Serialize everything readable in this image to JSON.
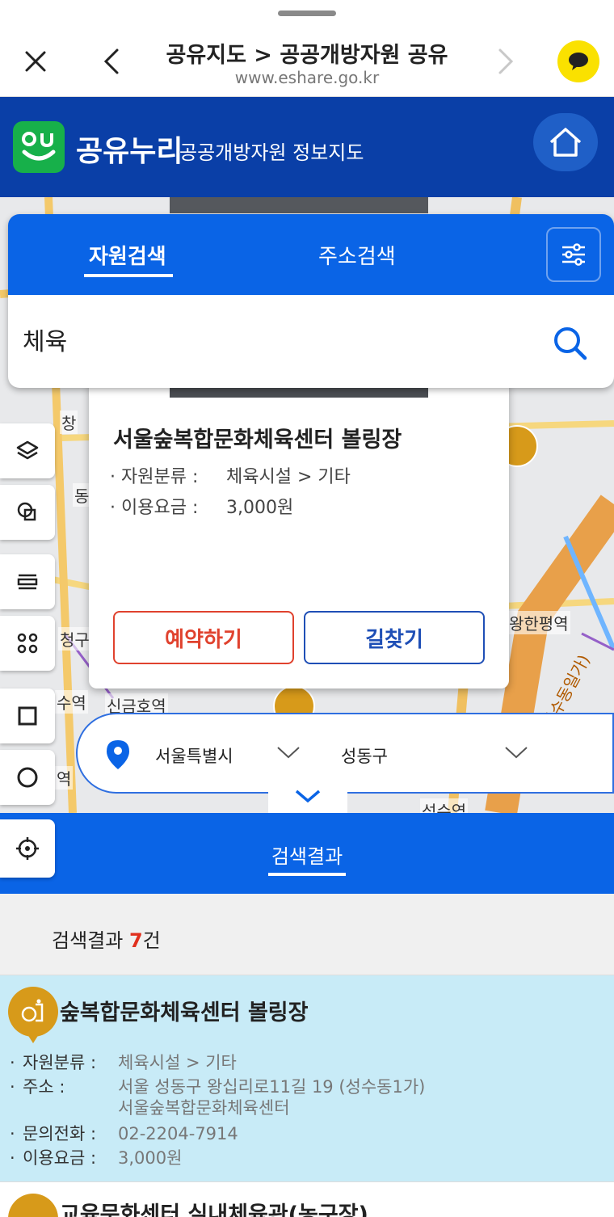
{
  "browser": {
    "title": "공유지도 > 공공개방자원 공유",
    "url": "www.eshare.go.kr"
  },
  "header": {
    "brand": "공유누리",
    "subtitle": "공공개방자원 정보지도"
  },
  "search": {
    "tabs": [
      {
        "label": "자원검색",
        "active": true
      },
      {
        "label": "주소검색",
        "active": false
      }
    ],
    "query": "체육"
  },
  "map": {
    "labels": [
      "창",
      "동",
      "청구",
      "수역",
      "신금호역",
      "역",
      "왕한평역",
      "(성수동일가)",
      "성수역"
    ]
  },
  "popup": {
    "title": "서울숲복합문화체육센터 볼링장",
    "rows": [
      {
        "key": "자원분류 :",
        "value": "체육시설 > 기타"
      },
      {
        "key": "이용요금 :",
        "value": "3,000원"
      }
    ],
    "reserve_label": "예약하기",
    "route_label": "길찾기"
  },
  "region": {
    "city": "서울특별시",
    "district": "성동구"
  },
  "results": {
    "tab_label": "검색결과",
    "count_prefix": "검색결과 ",
    "count": "7",
    "count_suffix": "건",
    "items": [
      {
        "title": "숲복합문화체육센터 볼링장",
        "category_key": "자원분류 :",
        "category": "체육시설 > 기타",
        "address_key": "주소 :",
        "address_line1": "서울 성동구 왕십리로11길 19 (성수동1가)",
        "address_line2": "서울숲복합문화체육센터",
        "phone_key": "문의전화 :",
        "phone": "02-2204-7914",
        "fee_key": "이용요금 :",
        "fee": "3,000원"
      },
      {
        "title": "교육문화센터 실내체육관(농구장)"
      }
    ]
  },
  "colors": {
    "primary_blue": "#0a64e6",
    "header_blue": "#0a3fa7",
    "reserve_red": "#e0422e",
    "pin_gold": "#d79a1a",
    "selected_item_bg": "#c8ebf7"
  }
}
